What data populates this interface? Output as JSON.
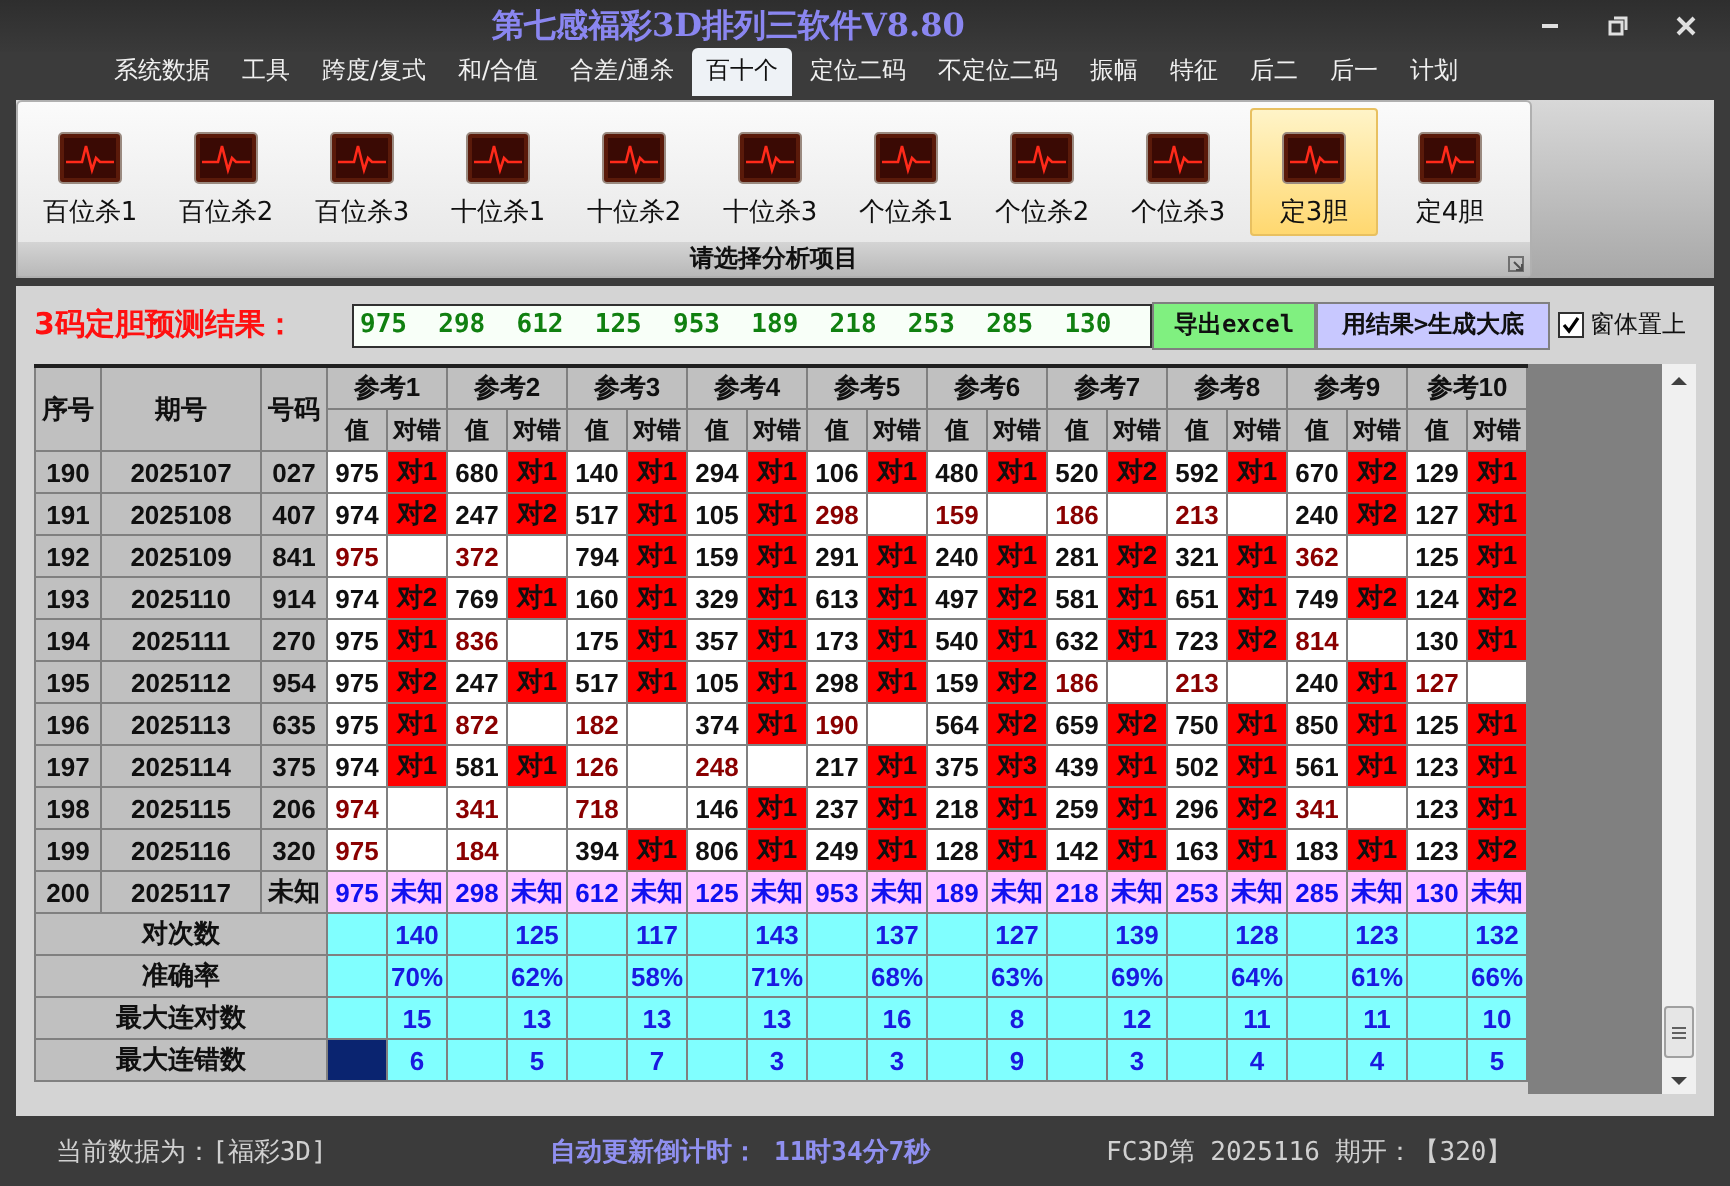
{
  "window": {
    "title": "第七感福彩3D排列三软件V8.80"
  },
  "menu": [
    {
      "label": "系统数据",
      "selected": false
    },
    {
      "label": "工具",
      "selected": false
    },
    {
      "label": "跨度/复式",
      "selected": false
    },
    {
      "label": "和/合值",
      "selected": false
    },
    {
      "label": "合差/通杀",
      "selected": false
    },
    {
      "label": "百十个",
      "selected": true
    },
    {
      "label": "定位二码",
      "selected": false
    },
    {
      "label": "不定位二码",
      "selected": false
    },
    {
      "label": "振幅",
      "selected": false
    },
    {
      "label": "特征",
      "selected": false
    },
    {
      "label": "后二",
      "selected": false
    },
    {
      "label": "后一",
      "selected": false
    },
    {
      "label": "计划",
      "selected": false
    }
  ],
  "ribbon": {
    "items": [
      {
        "label": "百位杀1",
        "selected": false
      },
      {
        "label": "百位杀2",
        "selected": false
      },
      {
        "label": "百位杀3",
        "selected": false
      },
      {
        "label": "十位杀1",
        "selected": false
      },
      {
        "label": "十位杀2",
        "selected": false
      },
      {
        "label": "十位杀3",
        "selected": false
      },
      {
        "label": "个位杀1",
        "selected": false
      },
      {
        "label": "个位杀2",
        "selected": false
      },
      {
        "label": "个位杀3",
        "selected": false
      },
      {
        "label": "定3胆",
        "selected": true
      },
      {
        "label": "定4胆",
        "selected": false
      }
    ],
    "group_label": "请选择分析项目"
  },
  "prediction": {
    "label": "3码定胆预测结果：",
    "value": "975  298  612  125  953  189  218  253  285  130",
    "buttons": [
      {
        "label": "导出excel",
        "kind": "export"
      },
      {
        "label": "用结果>生成大底",
        "kind": "generate"
      }
    ],
    "topmost": {
      "label": "窗体置上",
      "checked": true
    }
  },
  "table": {
    "columns": [
      "序号",
      "期号",
      "号码"
    ],
    "groups": [
      {
        "label": "参考1",
        "subcolumns": [
          "值",
          "对错"
        ]
      },
      {
        "label": "参考2",
        "subcolumns": [
          "值",
          "对错"
        ]
      },
      {
        "label": "参考3",
        "subcolumns": [
          "值",
          "对错"
        ]
      },
      {
        "label": "参考4",
        "subcolumns": [
          "值",
          "对错"
        ]
      },
      {
        "label": "参考5",
        "subcolumns": [
          "值",
          "对错"
        ]
      },
      {
        "label": "参考6",
        "subcolumns": [
          "值",
          "对错"
        ]
      },
      {
        "label": "参考7",
        "subcolumns": [
          "值",
          "对错"
        ]
      },
      {
        "label": "参考8",
        "subcolumns": [
          "值",
          "对错"
        ]
      },
      {
        "label": "参考9",
        "subcolumns": [
          "值",
          "对错"
        ]
      },
      {
        "label": "参考10",
        "subcolumns": [
          "值",
          "对错"
        ]
      }
    ],
    "rows": [
      {
        "seq": "190",
        "period": "2025107",
        "number": "027",
        "kind": "history",
        "refs": [
          {
            "value": "975",
            "hit": true,
            "result": "对1"
          },
          {
            "value": "680",
            "hit": true,
            "result": "对1"
          },
          {
            "value": "140",
            "hit": true,
            "result": "对1"
          },
          {
            "value": "294",
            "hit": true,
            "result": "对1"
          },
          {
            "value": "106",
            "hit": true,
            "result": "对1"
          },
          {
            "value": "480",
            "hit": true,
            "result": "对1"
          },
          {
            "value": "520",
            "hit": true,
            "result": "对2"
          },
          {
            "value": "592",
            "hit": true,
            "result": "对1"
          },
          {
            "value": "670",
            "hit": true,
            "result": "对2"
          },
          {
            "value": "129",
            "hit": true,
            "result": "对1"
          }
        ]
      },
      {
        "seq": "191",
        "period": "2025108",
        "number": "407",
        "kind": "history",
        "refs": [
          {
            "value": "974",
            "hit": true,
            "result": "对2"
          },
          {
            "value": "247",
            "hit": true,
            "result": "对2"
          },
          {
            "value": "517",
            "hit": true,
            "result": "对1"
          },
          {
            "value": "105",
            "hit": true,
            "result": "对1"
          },
          {
            "value": "298",
            "hit": false
          },
          {
            "value": "159",
            "hit": false
          },
          {
            "value": "186",
            "hit": false
          },
          {
            "value": "213",
            "hit": false
          },
          {
            "value": "240",
            "hit": true,
            "result": "对2"
          },
          {
            "value": "127",
            "hit": true,
            "result": "对1"
          }
        ]
      },
      {
        "seq": "192",
        "period": "2025109",
        "number": "841",
        "kind": "history",
        "refs": [
          {
            "value": "975",
            "hit": false
          },
          {
            "value": "372",
            "hit": false
          },
          {
            "value": "794",
            "hit": true,
            "result": "对1"
          },
          {
            "value": "159",
            "hit": true,
            "result": "对1"
          },
          {
            "value": "291",
            "hit": true,
            "result": "对1"
          },
          {
            "value": "240",
            "hit": true,
            "result": "对1"
          },
          {
            "value": "281",
            "hit": true,
            "result": "对2"
          },
          {
            "value": "321",
            "hit": true,
            "result": "对1"
          },
          {
            "value": "362",
            "hit": false
          },
          {
            "value": "125",
            "hit": true,
            "result": "对1"
          }
        ]
      },
      {
        "seq": "193",
        "period": "2025110",
        "number": "914",
        "kind": "history",
        "refs": [
          {
            "value": "974",
            "hit": true,
            "result": "对2"
          },
          {
            "value": "769",
            "hit": true,
            "result": "对1"
          },
          {
            "value": "160",
            "hit": true,
            "result": "对1"
          },
          {
            "value": "329",
            "hit": true,
            "result": "对1"
          },
          {
            "value": "613",
            "hit": true,
            "result": "对1"
          },
          {
            "value": "497",
            "hit": true,
            "result": "对2"
          },
          {
            "value": "581",
            "hit": true,
            "result": "对1"
          },
          {
            "value": "651",
            "hit": true,
            "result": "对1"
          },
          {
            "value": "749",
            "hit": true,
            "result": "对2"
          },
          {
            "value": "124",
            "hit": true,
            "result": "对2"
          }
        ]
      },
      {
        "seq": "194",
        "period": "2025111",
        "number": "270",
        "kind": "history",
        "refs": [
          {
            "value": "975",
            "hit": true,
            "result": "对1"
          },
          {
            "value": "836",
            "hit": false
          },
          {
            "value": "175",
            "hit": true,
            "result": "对1"
          },
          {
            "value": "357",
            "hit": true,
            "result": "对1"
          },
          {
            "value": "173",
            "hit": true,
            "result": "对1"
          },
          {
            "value": "540",
            "hit": true,
            "result": "对1"
          },
          {
            "value": "632",
            "hit": true,
            "result": "对1"
          },
          {
            "value": "723",
            "hit": true,
            "result": "对2"
          },
          {
            "value": "814",
            "hit": false
          },
          {
            "value": "130",
            "hit": true,
            "result": "对1"
          }
        ]
      },
      {
        "seq": "195",
        "period": "2025112",
        "number": "954",
        "kind": "history",
        "refs": [
          {
            "value": "975",
            "hit": true,
            "result": "对2"
          },
          {
            "value": "247",
            "hit": true,
            "result": "对1"
          },
          {
            "value": "517",
            "hit": true,
            "result": "对1"
          },
          {
            "value": "105",
            "hit": true,
            "result": "对1"
          },
          {
            "value": "298",
            "hit": true,
            "result": "对1"
          },
          {
            "value": "159",
            "hit": true,
            "result": "对2"
          },
          {
            "value": "186",
            "hit": false
          },
          {
            "value": "213",
            "hit": false
          },
          {
            "value": "240",
            "hit": true,
            "result": "对1"
          },
          {
            "value": "127",
            "hit": false
          }
        ]
      },
      {
        "seq": "196",
        "period": "2025113",
        "number": "635",
        "kind": "history",
        "refs": [
          {
            "value": "975",
            "hit": true,
            "result": "对1"
          },
          {
            "value": "872",
            "hit": false
          },
          {
            "value": "182",
            "hit": false
          },
          {
            "value": "374",
            "hit": true,
            "result": "对1"
          },
          {
            "value": "190",
            "hit": false
          },
          {
            "value": "564",
            "hit": true,
            "result": "对2"
          },
          {
            "value": "659",
            "hit": true,
            "result": "对2"
          },
          {
            "value": "750",
            "hit": true,
            "result": "对1"
          },
          {
            "value": "850",
            "hit": true,
            "result": "对1"
          },
          {
            "value": "125",
            "hit": true,
            "result": "对1"
          }
        ]
      },
      {
        "seq": "197",
        "period": "2025114",
        "number": "375",
        "kind": "history",
        "refs": [
          {
            "value": "974",
            "hit": true,
            "result": "对1"
          },
          {
            "value": "581",
            "hit": true,
            "result": "对1"
          },
          {
            "value": "126",
            "hit": false
          },
          {
            "value": "248",
            "hit": false
          },
          {
            "value": "217",
            "hit": true,
            "result": "对1"
          },
          {
            "value": "375",
            "hit": true,
            "result": "对3"
          },
          {
            "value": "439",
            "hit": true,
            "result": "对1"
          },
          {
            "value": "502",
            "hit": true,
            "result": "对1"
          },
          {
            "value": "561",
            "hit": true,
            "result": "对1"
          },
          {
            "value": "123",
            "hit": true,
            "result": "对1"
          }
        ]
      },
      {
        "seq": "198",
        "period": "2025115",
        "number": "206",
        "kind": "history",
        "refs": [
          {
            "value": "974",
            "hit": false
          },
          {
            "value": "341",
            "hit": false
          },
          {
            "value": "718",
            "hit": false
          },
          {
            "value": "146",
            "hit": true,
            "result": "对1"
          },
          {
            "value": "237",
            "hit": true,
            "result": "对1"
          },
          {
            "value": "218",
            "hit": true,
            "result": "对1"
          },
          {
            "value": "259",
            "hit": true,
            "result": "对1"
          },
          {
            "value": "296",
            "hit": true,
            "result": "对2"
          },
          {
            "value": "341",
            "hit": false
          },
          {
            "value": "123",
            "hit": true,
            "result": "对1"
          }
        ]
      },
      {
        "seq": "199",
        "period": "2025116",
        "number": "320",
        "kind": "history",
        "refs": [
          {
            "value": "975",
            "hit": false
          },
          {
            "value": "184",
            "hit": false
          },
          {
            "value": "394",
            "hit": true,
            "result": "对1"
          },
          {
            "value": "806",
            "hit": true,
            "result": "对1"
          },
          {
            "value": "249",
            "hit": true,
            "result": "对1"
          },
          {
            "value": "128",
            "hit": true,
            "result": "对1"
          },
          {
            "value": "142",
            "hit": true,
            "result": "对1"
          },
          {
            "value": "163",
            "hit": true,
            "result": "对1"
          },
          {
            "value": "183",
            "hit": true,
            "result": "对1"
          },
          {
            "value": "123",
            "hit": true,
            "result": "对2"
          }
        ]
      },
      {
        "seq": "200",
        "period": "2025117",
        "number": "未知",
        "kind": "pending",
        "refs": [
          {
            "value": "975",
            "result": "未知"
          },
          {
            "value": "298",
            "result": "未知"
          },
          {
            "value": "612",
            "result": "未知"
          },
          {
            "value": "125",
            "result": "未知"
          },
          {
            "value": "953",
            "result": "未知"
          },
          {
            "value": "189",
            "result": "未知"
          },
          {
            "value": "218",
            "result": "未知"
          },
          {
            "value": "253",
            "result": "未知"
          },
          {
            "value": "285",
            "result": "未知"
          },
          {
            "value": "130",
            "result": "未知"
          }
        ]
      }
    ],
    "stats": [
      {
        "label": "对次数",
        "cells": [
          {
            "value": "140",
            "selected": false
          },
          {
            "value": "125",
            "selected": false
          },
          {
            "value": "117",
            "selected": false
          },
          {
            "value": "143",
            "selected": false
          },
          {
            "value": "137",
            "selected": false
          },
          {
            "value": "127",
            "selected": false
          },
          {
            "value": "139",
            "selected": false
          },
          {
            "value": "128",
            "selected": false
          },
          {
            "value": "123",
            "selected": false
          },
          {
            "value": "132",
            "selected": false
          }
        ]
      },
      {
        "label": "准确率",
        "cells": [
          {
            "value": "70%",
            "selected": false
          },
          {
            "value": "62%",
            "selected": false
          },
          {
            "value": "58%",
            "selected": false
          },
          {
            "value": "71%",
            "selected": false
          },
          {
            "value": "68%",
            "selected": false
          },
          {
            "value": "63%",
            "selected": false
          },
          {
            "value": "69%",
            "selected": false
          },
          {
            "value": "64%",
            "selected": false
          },
          {
            "value": "61%",
            "selected": false
          },
          {
            "value": "66%",
            "selected": false
          }
        ]
      },
      {
        "label": "最大连对数",
        "cells": [
          {
            "value": "15",
            "selected": false
          },
          {
            "value": "13",
            "selected": false
          },
          {
            "value": "13",
            "selected": false
          },
          {
            "value": "13",
            "selected": false
          },
          {
            "value": "16",
            "selected": false
          },
          {
            "value": "8",
            "selected": false
          },
          {
            "value": "12",
            "selected": false
          },
          {
            "value": "11",
            "selected": false
          },
          {
            "value": "11",
            "selected": false
          },
          {
            "value": "10",
            "selected": false
          }
        ]
      },
      {
        "label": "最大连错数",
        "cells": [
          {
            "value": "6",
            "selected": true
          },
          {
            "value": "5",
            "selected": false
          },
          {
            "value": "7",
            "selected": false
          },
          {
            "value": "3",
            "selected": false
          },
          {
            "value": "3",
            "selected": false
          },
          {
            "value": "9",
            "selected": false
          },
          {
            "value": "3",
            "selected": false
          },
          {
            "value": "4",
            "selected": false
          },
          {
            "value": "4",
            "selected": false
          },
          {
            "value": "5",
            "selected": false
          }
        ]
      }
    ]
  },
  "status_bar": {
    "data_source": "当前数据为：[福彩3D]",
    "countdown_label": "自动更新倒计时：",
    "countdown": "11时34分7秒",
    "last_draw": "FC3D第 2025116 期开：【320】"
  }
}
